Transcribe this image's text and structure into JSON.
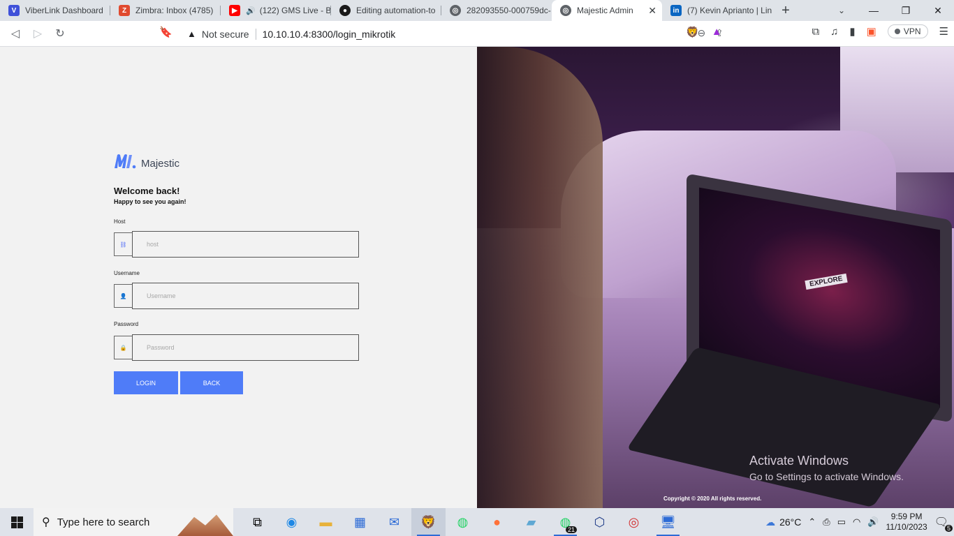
{
  "browser": {
    "tabs": [
      {
        "title": "ViberLink Dashboard",
        "icon": "viberlink-icon",
        "color": "#3f51d9"
      },
      {
        "title": "Zimbra: Inbox (4785)",
        "icon": "zimbra-icon",
        "color": "#e04a2f"
      },
      {
        "title": "(122) GMS Live - B",
        "icon": "youtube-icon",
        "color": "#ff0000"
      },
      {
        "title": "Editing automation-to",
        "icon": "github-icon",
        "color": "#1a1a1a"
      },
      {
        "title": "282093550-000759dc-",
        "icon": "globe-icon",
        "color": "#5f6368"
      },
      {
        "title": "Majestic Admin",
        "icon": "globe-icon",
        "color": "#5f6368"
      },
      {
        "title": "(7) Kevin Aprianto | Lin",
        "icon": "linkedin-icon",
        "color": "#0a66c2"
      }
    ],
    "security_label": "Not secure",
    "url": "10.10.10.4:8300/login_mikrotik",
    "vpn_label": "VPN"
  },
  "login": {
    "brand": "Majestic",
    "welcome": "Welcome back!",
    "subtitle": "Happy to see you again!",
    "host_label": "Host",
    "host_placeholder": "host",
    "username_label": "Username",
    "username_placeholder": "Username",
    "password_label": "Password",
    "password_placeholder": "Password",
    "login_button": "LOGIN",
    "back_button": "BACK",
    "accent_color": "#4f7cf8"
  },
  "hero": {
    "screen_text": "EXPLORE",
    "copyright": "Copyright © 2020 All rights reserved."
  },
  "watermark": {
    "line1": "Activate Windows",
    "line2": "Go to Settings to activate Windows."
  },
  "taskbar": {
    "search_placeholder": "Type here to search",
    "whatsapp_badge": "21",
    "temperature": "26°C",
    "time": "9:59 PM",
    "date": "11/10/2023",
    "notifications": "5"
  }
}
